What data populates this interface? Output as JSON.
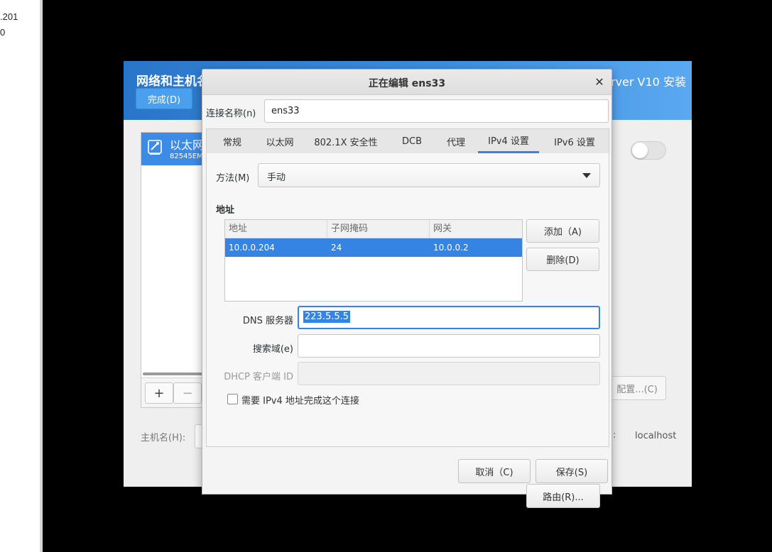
{
  "host": {
    "line1": ".201",
    "line2": "0"
  },
  "installer": {
    "title_fragment": "网络和主机名",
    "right_title_fragment": "rver V10 安装",
    "done_label": "完成(D)",
    "connection_item": {
      "label": "以太网",
      "sublabel": "82545EM"
    },
    "add_symbol": "+",
    "remove_symbol": "−",
    "config_label": "配置...(C)",
    "hostname_label": "主机名(H):",
    "current_hostname_colon": ":",
    "current_hostname": "localhost",
    "toggle_on": false
  },
  "dialog": {
    "title": "正在编辑 ens33",
    "close_symbol": "✕",
    "conn_name_label": "连接名称(n)",
    "conn_name_value": "ens33",
    "tabs": [
      "常规",
      "以太网",
      "802.1X 安全性",
      "DCB",
      "代理",
      "IPv4 设置",
      "IPv6 设置"
    ],
    "active_tab": "IPv4 设置",
    "method_label": "方法(M)",
    "method_value": "手动",
    "address_heading": "地址",
    "address_columns": [
      "地址",
      "子网掩码",
      "网关"
    ],
    "address_rows": [
      [
        "10.0.0.204",
        "24",
        "10.0.0.2"
      ]
    ],
    "add_button": "添加（A)",
    "delete_button": "删除(D)",
    "dns_label": "DNS 服务器",
    "dns_value": "223.5.5.5",
    "search_label": "搜索域(e)",
    "search_value": "",
    "dhcp_label": "DHCP 客户端 ID",
    "dhcp_value": "",
    "require_ipv4_label": "需要 IPv4 地址完成这个连接",
    "require_ipv4_checked": false,
    "routes_button": "路由(R)...",
    "cancel_button": "取消（C)",
    "save_button": "保存(S)"
  },
  "colors": {
    "accent": "#3584e4",
    "header_blue": "#2a75c9"
  }
}
